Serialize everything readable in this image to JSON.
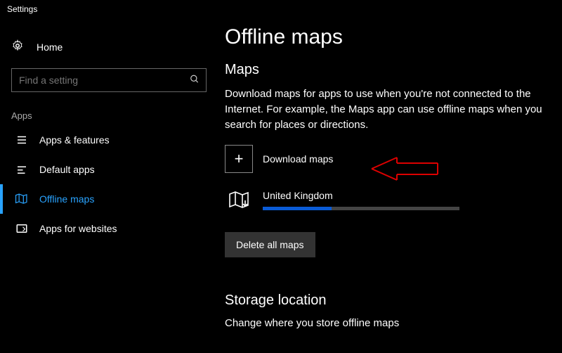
{
  "window": {
    "title": "Settings"
  },
  "sidebar": {
    "home_label": "Home",
    "search_placeholder": "Find a setting",
    "section_label": "Apps",
    "items": [
      {
        "label": "Apps & features"
      },
      {
        "label": "Default apps"
      },
      {
        "label": "Offline maps"
      },
      {
        "label": "Apps for websites"
      }
    ],
    "active_index": 2
  },
  "main": {
    "page_title": "Offline maps",
    "maps_heading": "Maps",
    "description": "Download maps for apps to use when you're not connected to the Internet. For example, the Maps app can use offline maps when you search for places or directions.",
    "download_label": "Download maps",
    "downloads": [
      {
        "name": "United Kingdom",
        "progress_pct": 35
      }
    ],
    "delete_label": "Delete all maps",
    "storage_heading": "Storage location",
    "storage_desc": "Change where you store offline maps"
  }
}
